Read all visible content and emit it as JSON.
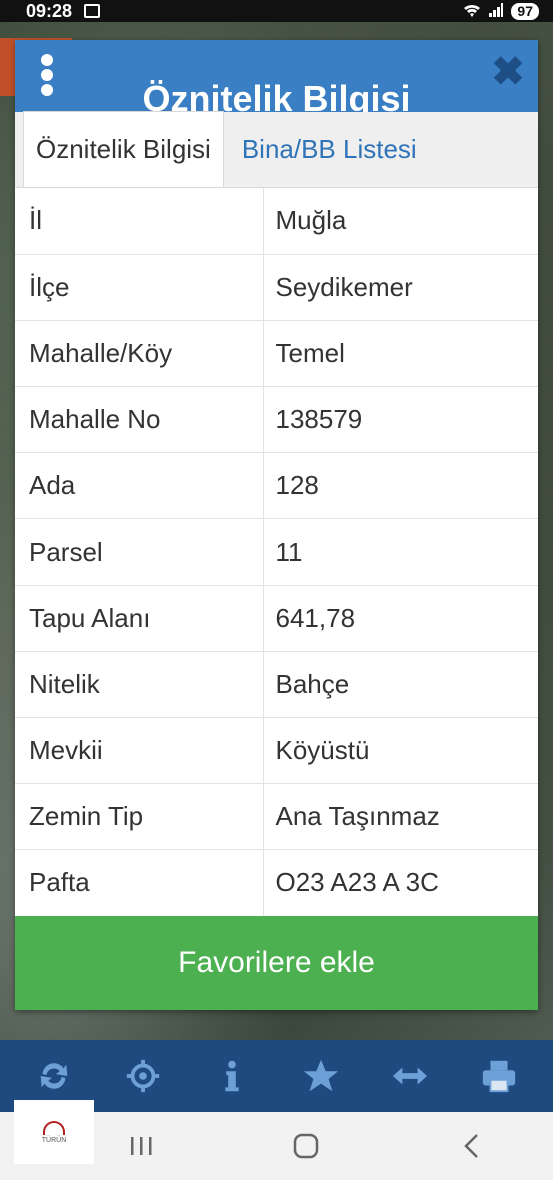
{
  "status_bar": {
    "time": "09:28",
    "battery": "97"
  },
  "dialog": {
    "title": "Öznitelik Bilgisi",
    "close_icon": "close-icon",
    "menu_icon": "more-vert-icon",
    "tabs": [
      {
        "label": "Öznitelik Bilgisi",
        "active": true
      },
      {
        "label": "Bina/BB Listesi",
        "active": false
      }
    ],
    "rows": [
      {
        "key": "İl",
        "value": "Muğla"
      },
      {
        "key": "İlçe",
        "value": "Seydikemer"
      },
      {
        "key": "Mahalle/Köy",
        "value": "Temel"
      },
      {
        "key": "Mahalle No",
        "value": "138579"
      },
      {
        "key": "Ada",
        "value": "128"
      },
      {
        "key": "Parsel",
        "value": "11"
      },
      {
        "key": "Tapu Alanı",
        "value": "641,78"
      },
      {
        "key": "Nitelik",
        "value": "Bahçe"
      },
      {
        "key": "Mevkii",
        "value": "Köyüstü"
      },
      {
        "key": "Zemin Tip",
        "value": "Ana Taşınmaz"
      },
      {
        "key": "Pafta",
        "value": "O23 A23 A 3C"
      }
    ],
    "favorite_button": "Favorilere ekle"
  },
  "toolbar": {
    "icons": [
      "refresh-icon",
      "locate-icon",
      "info-icon",
      "star-icon",
      "measure-icon",
      "print-icon"
    ]
  },
  "logo": {
    "text": "TÜRÜN"
  },
  "colors": {
    "header": "#3a7ec4",
    "tab_link": "#2f73b8",
    "favorite_button": "#4caf50",
    "toolbar": "#1f4a80"
  }
}
